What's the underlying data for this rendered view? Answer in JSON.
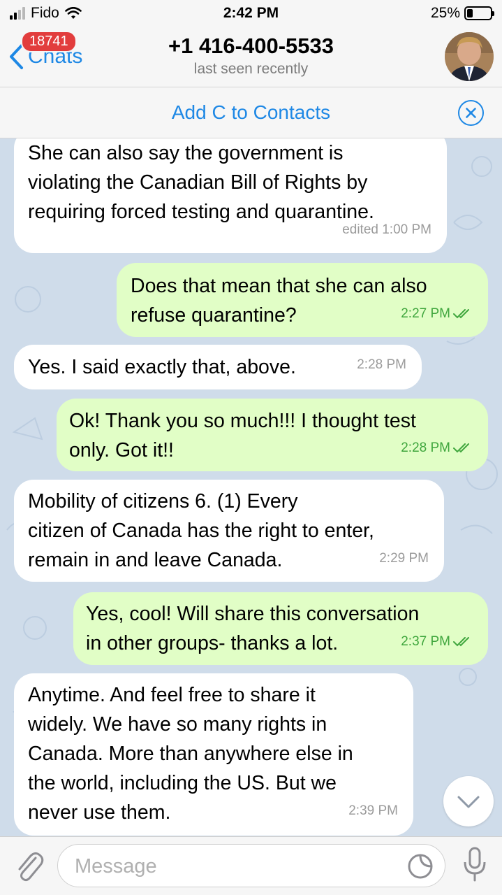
{
  "status_bar": {
    "carrier": "Fido",
    "time": "2:42 PM",
    "battery": "25%",
    "battery_level": 0.25
  },
  "header": {
    "back_label": "Chats",
    "unread_badge": "18741",
    "title": "+1 416-400-5533",
    "subtitle": "last seen recently"
  },
  "add_contact": {
    "label": "Add C to Contacts"
  },
  "messages": [
    {
      "direction": "in",
      "text": "She can also say the government is\nviolating the Canadian Bill of Rights by\nrequiring forced testing and quarantine.",
      "meta": "edited 1:00 PM"
    },
    {
      "direction": "out",
      "text": "Does that mean that she can also\nrefuse quarantine?",
      "meta": "2:27 PM",
      "read": true
    },
    {
      "direction": "in",
      "text": "Yes. I said exactly that, above.",
      "meta": "2:28 PM"
    },
    {
      "direction": "out",
      "text": "Ok! Thank you so much!!! I thought test\nonly. Got it!!",
      "meta": "2:28 PM",
      "read": true
    },
    {
      "direction": "in",
      "text": "Mobility of citizens   6.     (1) Every\ncitizen of Canada has the right to enter,\nremain in and leave Canada.",
      "meta": "2:29 PM"
    },
    {
      "direction": "out",
      "text": "Yes, cool! Will share this conversation\nin other groups- thanks a lot.",
      "meta": "2:37 PM",
      "read": true
    },
    {
      "direction": "in",
      "text": "Anytime. And feel free to share it\nwidely. We have so many rights in\nCanada. More than anywhere else in\nthe world, including the US. But we\nnever use them.",
      "meta": "2:39 PM"
    }
  ],
  "input": {
    "placeholder": "Message"
  },
  "colors": {
    "accent": "#1e88e5",
    "incoming": "#ffffff",
    "outgoing": "#e1fec6",
    "chat_bg": "#cfdcea",
    "badge": "#e23d3d",
    "read_tick": "#3fa63d"
  },
  "icons": [
    "back-chevron-icon",
    "close-circle-icon",
    "chevron-down-icon",
    "paperclip-icon",
    "sticker-icon",
    "microphone-icon",
    "double-check-icon"
  ]
}
